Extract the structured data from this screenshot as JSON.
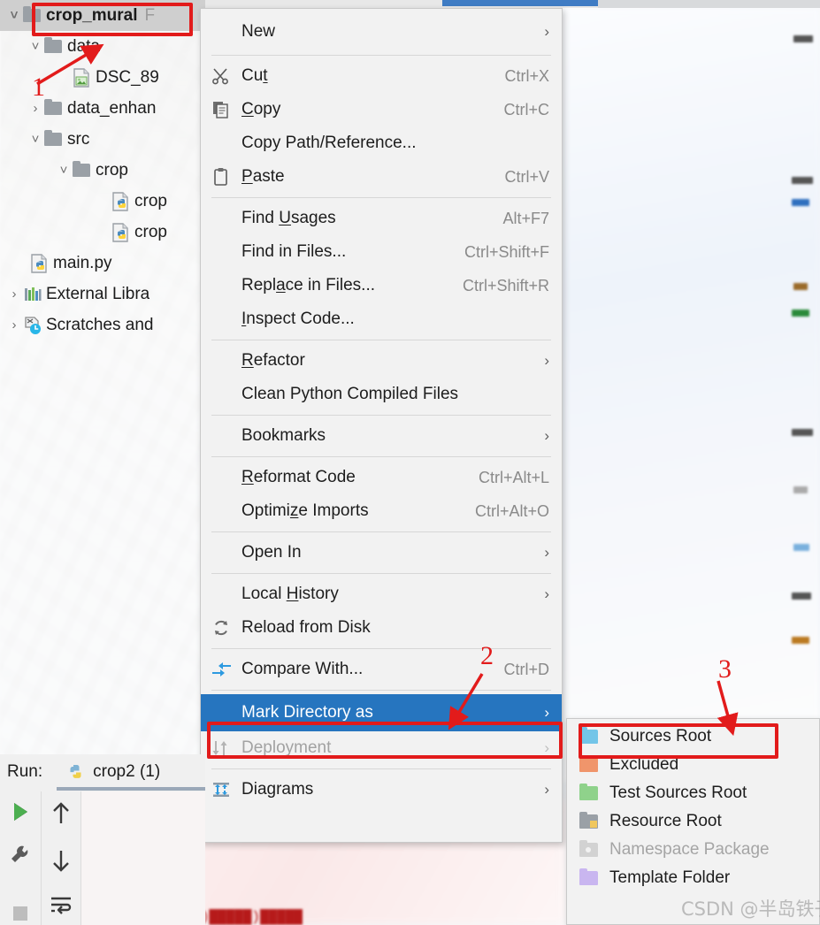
{
  "tree": {
    "items": [
      {
        "arrow": "v",
        "icon": "folder-icon",
        "label": "crop_mural",
        "suffix": "F",
        "indent": 0,
        "selected": true
      },
      {
        "arrow": "v",
        "icon": "folder-icon",
        "label": "data",
        "indent": 1,
        "selected": false
      },
      {
        "arrow": "",
        "icon": "image-file-icon",
        "label": "DSC_89",
        "indent": 2,
        "selected": false
      },
      {
        "arrow": ">",
        "icon": "folder-icon",
        "label": "data_enhan",
        "indent": 1,
        "selected": false
      },
      {
        "arrow": "v",
        "icon": "folder-icon",
        "label": "src",
        "indent": 1,
        "selected": false
      },
      {
        "arrow": "v",
        "icon": "folder-icon",
        "label": "crop",
        "indent": 2,
        "selected": false
      },
      {
        "arrow": "",
        "icon": "python-file-icon",
        "label": "crop",
        "indent": 3,
        "selected": false
      },
      {
        "arrow": "",
        "icon": "python-file-icon",
        "label": "crop",
        "indent": 3,
        "selected": false
      },
      {
        "arrow": "",
        "icon": "python-file-icon",
        "label": "main.py",
        "indent": 1,
        "selected": false
      },
      {
        "arrow": ">",
        "icon": "external-libraries-icon",
        "label": "External Libra",
        "indent": 0,
        "selected": false
      },
      {
        "arrow": ">",
        "icon": "scratches-icon",
        "label": "Scratches and",
        "indent": 0,
        "selected": false
      }
    ]
  },
  "context_menu": {
    "items": [
      {
        "label": "New",
        "icon": "",
        "accel": "",
        "arrow": "›",
        "state": "normal",
        "sep_after": true
      },
      {
        "label": "Cut",
        "icon": "scissors-icon",
        "accel": "Ctrl+X",
        "arrow": "",
        "state": "normal",
        "sep_after": false
      },
      {
        "label": "Copy",
        "icon": "copy-icon",
        "accel": "Ctrl+C",
        "arrow": "",
        "state": "normal",
        "sep_after": false
      },
      {
        "label": "Copy Path/Reference...",
        "icon": "",
        "accel": "",
        "arrow": "",
        "state": "normal",
        "sep_after": false
      },
      {
        "label": "Paste",
        "icon": "clipboard-icon",
        "accel": "Ctrl+V",
        "arrow": "",
        "state": "normal",
        "sep_after": true
      },
      {
        "label": "Find Usages",
        "icon": "",
        "accel": "Alt+F7",
        "arrow": "",
        "state": "normal",
        "sep_after": false
      },
      {
        "label": "Find in Files...",
        "icon": "",
        "accel": "Ctrl+Shift+F",
        "arrow": "",
        "state": "normal",
        "sep_after": false
      },
      {
        "label": "Replace in Files...",
        "icon": "",
        "accel": "Ctrl+Shift+R",
        "arrow": "",
        "state": "normal",
        "sep_after": false
      },
      {
        "label": "Inspect Code...",
        "icon": "",
        "accel": "",
        "arrow": "",
        "state": "normal",
        "sep_after": true
      },
      {
        "label": "Refactor",
        "icon": "",
        "accel": "",
        "arrow": "›",
        "state": "normal",
        "sep_after": false
      },
      {
        "label": "Clean Python Compiled Files",
        "icon": "",
        "accel": "",
        "arrow": "",
        "state": "normal",
        "sep_after": true
      },
      {
        "label": "Bookmarks",
        "icon": "",
        "accel": "",
        "arrow": "›",
        "state": "normal",
        "sep_after": true
      },
      {
        "label": "Reformat Code",
        "icon": "",
        "accel": "Ctrl+Alt+L",
        "arrow": "",
        "state": "normal",
        "sep_after": false
      },
      {
        "label": "Optimize Imports",
        "icon": "",
        "accel": "Ctrl+Alt+O",
        "arrow": "",
        "state": "normal",
        "sep_after": true
      },
      {
        "label": "Open In",
        "icon": "",
        "accel": "",
        "arrow": "›",
        "state": "normal",
        "sep_after": true
      },
      {
        "label": "Local History",
        "icon": "",
        "accel": "",
        "arrow": "›",
        "state": "normal",
        "sep_after": false
      },
      {
        "label": "Reload from Disk",
        "icon": "refresh-icon",
        "accel": "",
        "arrow": "",
        "state": "normal",
        "sep_after": true
      },
      {
        "label": "Compare With...",
        "icon": "compare-icon",
        "accel": "Ctrl+D",
        "arrow": "",
        "state": "normal",
        "sep_after": true
      },
      {
        "label": "Mark Directory as",
        "icon": "",
        "accel": "",
        "arrow": "›",
        "state": "highlight",
        "sep_after": false
      },
      {
        "label": "Deployment",
        "icon": "deployment-icon",
        "accel": "",
        "arrow": "›",
        "state": "disabled",
        "sep_after": true
      },
      {
        "label": "Diagrams",
        "icon": "diagrams-icon",
        "accel": "",
        "arrow": "›",
        "state": "normal",
        "sep_after": false
      }
    ]
  },
  "submenu": {
    "items": [
      {
        "label": "Sources Root",
        "color": "#73c5e8",
        "state": "normal",
        "icon": "folder-icon"
      },
      {
        "label": "Excluded",
        "color": "#f0956b",
        "state": "normal",
        "icon": "folder-icon"
      },
      {
        "label": "Test Sources Root",
        "color": "#8fd28b",
        "state": "normal",
        "icon": "folder-icon"
      },
      {
        "label": "Resource Root",
        "color": "#9aa0a6",
        "state": "normal",
        "icon": "folder-icon"
      },
      {
        "label": "Namespace Package",
        "color": "#d2d2d2",
        "state": "disabled",
        "icon": "folder-icon"
      },
      {
        "label": "Template Folder",
        "color": "#c9b6f0",
        "state": "normal",
        "icon": "folder-icon"
      }
    ]
  },
  "run_panel": {
    "title": "Run:",
    "config_name": "crop2 (1)",
    "config_icon": "python-icon",
    "buttons": [
      {
        "name": "run-button",
        "icon": "play-icon"
      },
      {
        "name": "settings-button",
        "icon": "wrench-icon"
      },
      {
        "name": "stop-button",
        "icon": "stop-icon"
      },
      {
        "name": "scroll-up-button",
        "icon": "arrow-up-icon"
      },
      {
        "name": "scroll-down-button",
        "icon": "arrow-down-icon"
      },
      {
        "name": "soft-wrap-button",
        "icon": "soft-wrap-icon"
      }
    ]
  },
  "annotations": {
    "step1": "1",
    "step2": "2",
    "step3": "3"
  },
  "watermark": "CSDN @半岛铁子_",
  "console_text": "blob@█b█)█████)█████",
  "colors": {
    "highlight": "#2675bf",
    "annotation": "#e21b1b",
    "menu_bg": "#f2f2f2"
  }
}
